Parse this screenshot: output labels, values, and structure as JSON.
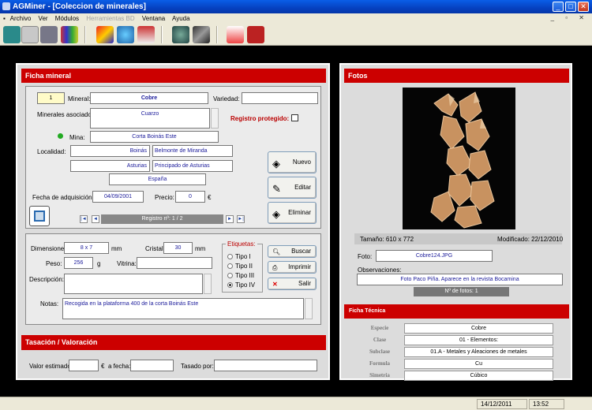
{
  "window": {
    "title": "AGMiner - [Coleccion de minerales]"
  },
  "menu": {
    "items": [
      "Archivo",
      "Ver",
      "Módulos",
      "Herramientas BD",
      "Ventana",
      "Ayuda"
    ]
  },
  "ficha": {
    "header": "Ficha mineral",
    "num": "1",
    "mineral_label": "Mineral:",
    "mineral": "Cobre",
    "variedad_label": "Variedad:",
    "variedad": "",
    "asociados_label": "Minerales asociados:",
    "asociados": "Cuarzo",
    "protegido_label": "Registro protegido:",
    "mina_label": "Mina:",
    "mina": "Corta Boinás Este",
    "localidad_label": "Localidad:",
    "loc1a": "Boinás",
    "loc1b": "Belmonte de Miranda",
    "loc2a": "Asturias",
    "loc2b": "Principado de Asturias",
    "pais": "España",
    "fecha_label": "Fecha de adquisición:",
    "fecha": "04/09/2001",
    "precio_label": "Precio:",
    "precio": "0",
    "currency": "€",
    "nav_record": "Registro nº: 1 / 2",
    "btn_nuevo": "Nuevo",
    "btn_editar": "Editar",
    "btn_eliminar": "Eliminar"
  },
  "detalle": {
    "dim_label": "Dimensiones:",
    "dim": "8 x 7",
    "mm": "mm",
    "cristal_label": "Cristal:",
    "cristal": "30",
    "peso_label": "Peso:",
    "peso": "256",
    "g": "g",
    "vitrina_label": "Vitrina:",
    "vitrina": "",
    "desc_label": "Descripción:",
    "desc": "",
    "notas_label": "Notas:",
    "notas": "Recogida en la plataforma 400 de la corta Boinás Este",
    "etiquetas_title": "Etiquetas:",
    "etiquetas": [
      "Tipo I",
      "Tipo II",
      "Tipo III",
      "Tipo IV"
    ],
    "etiqueta_selected": "Tipo IV",
    "btn_buscar": "Buscar",
    "btn_imprimir": "Imprimir",
    "btn_salir": "Salir"
  },
  "tasacion": {
    "header": "Tasación / Valoración",
    "valor_label": "Valor estimado:",
    "valor": "",
    "currency": "€",
    "fecha_label": "a fecha:",
    "fecha": "",
    "tasado_label": "Tasado por:",
    "tasado": ""
  },
  "fotos": {
    "header": "Fotos",
    "tamano": "Tamaño: 610 x 772",
    "modificado": "Modificado: 22/12/2010",
    "foto_label": "Foto:",
    "foto": "Cobre124.JPG",
    "obs_label": "Observaciones:",
    "obs": "Foto Paco Piña. Aparece en la revista Bocamina",
    "num_fotos": "Nº de fotos: 1"
  },
  "tecnica": {
    "header": "Ficha Técnica",
    "rows": [
      {
        "label": "Especie",
        "value": "Cobre"
      },
      {
        "label": "Clase",
        "value": "01 - Elementos:"
      },
      {
        "label": "Subclase",
        "value": "01.A - Metales y Aleaciones de metales"
      },
      {
        "label": "Formula",
        "value": "Cu"
      },
      {
        "label": "Simetria",
        "value": "Cúbico"
      }
    ]
  },
  "status": {
    "date": "14/12/2011",
    "time": "13:52"
  },
  "colors": {
    "header_red": "#cc0000",
    "titlebar_blue": "#0a5ee8",
    "field_text": "#1a1a9a"
  }
}
